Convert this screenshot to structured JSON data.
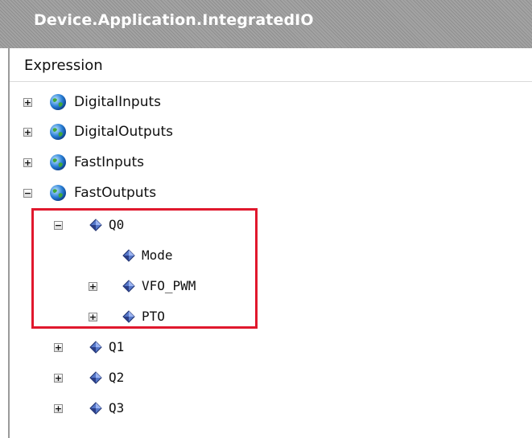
{
  "window": {
    "title": "Device.Application.IntegratedIO"
  },
  "table": {
    "header": "Expression"
  },
  "tree": {
    "digital_inputs": {
      "label": "DigitalInputs",
      "expander": "+"
    },
    "digital_outputs": {
      "label": "DigitalOutputs",
      "expander": "+"
    },
    "fast_inputs": {
      "label": "FastInputs",
      "expander": "+"
    },
    "fast_outputs": {
      "label": "FastOutputs",
      "expander": "−"
    },
    "q0": {
      "label": "Q0",
      "expander": "−"
    },
    "mode": {
      "label": "Mode"
    },
    "vfo_pwm": {
      "label": "VFO_PWM",
      "expander": "+"
    },
    "pto": {
      "label": "PTO",
      "expander": "+"
    },
    "q1": {
      "label": "Q1",
      "expander": "+"
    },
    "q2": {
      "label": "Q2",
      "expander": "+"
    },
    "q3": {
      "label": "Q3",
      "expander": "+"
    }
  },
  "icons": {
    "folder_icon": "globe-icon",
    "variable_icon": "variable-icon"
  },
  "colors": {
    "highlight": "#e0182d",
    "title_bg": "#9a9a9a"
  }
}
